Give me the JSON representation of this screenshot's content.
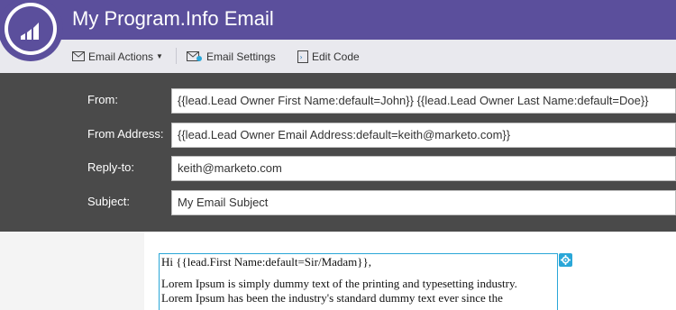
{
  "header": {
    "title": "My Program.Info Email"
  },
  "toolbar": {
    "email_actions": "Email Actions",
    "email_settings": "Email Settings",
    "edit_code": "Edit Code"
  },
  "form": {
    "from_label": "From:",
    "from_value": "{{lead.Lead Owner First Name:default=John}} {{lead.Lead Owner Last Name:default=Doe}}",
    "from_address_label": "From Address:",
    "from_address_value": "{{lead.Lead Owner Email Address:default=keith@marketo.com}}",
    "reply_to_label": "Reply-to:",
    "reply_to_value": "keith@marketo.com",
    "subject_label": "Subject:",
    "subject_value": "My Email Subject"
  },
  "editor": {
    "greeting": "Hi {{lead.First Name:default=Sir/Madam}},",
    "line1": "Lorem Ipsum is simply dummy text of the printing and typesetting industry.",
    "line2": "Lorem Ipsum has been the industry's standard dummy text ever since the"
  },
  "colors": {
    "brand": "#5b4f9c",
    "form_bg": "#4a4a4a",
    "selection": "#2aa7d8"
  }
}
